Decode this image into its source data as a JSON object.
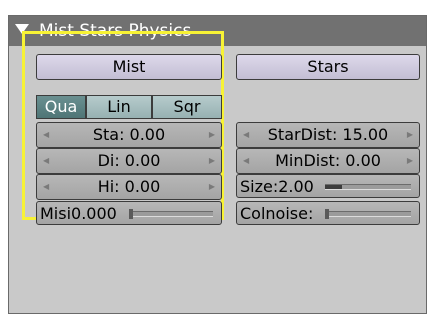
{
  "panel": {
    "title": "Mist Stars Physics",
    "accent_color": "#f7f235",
    "header_color": "#717171"
  },
  "mist": {
    "toggle_label": "Mist",
    "falloff": {
      "options": [
        "Qua",
        "Lin",
        "Sqr"
      ],
      "selected": "Qua"
    },
    "sta": "Sta: 0.00",
    "di": "Di: 0.00",
    "hi": "Hi: 0.00",
    "misi_label": "Misi",
    "misi_value": "0.000",
    "misi_fraction": 0.0
  },
  "stars": {
    "toggle_label": "Stars",
    "stardist": "StarDist: 15.00",
    "mindist": "MinDist: 0.00",
    "size_label": "Size:",
    "size_value": "2.00",
    "size_fraction": 0.2,
    "colnoise_label": "Colnoise:",
    "colnoise_fraction": 0.0
  }
}
